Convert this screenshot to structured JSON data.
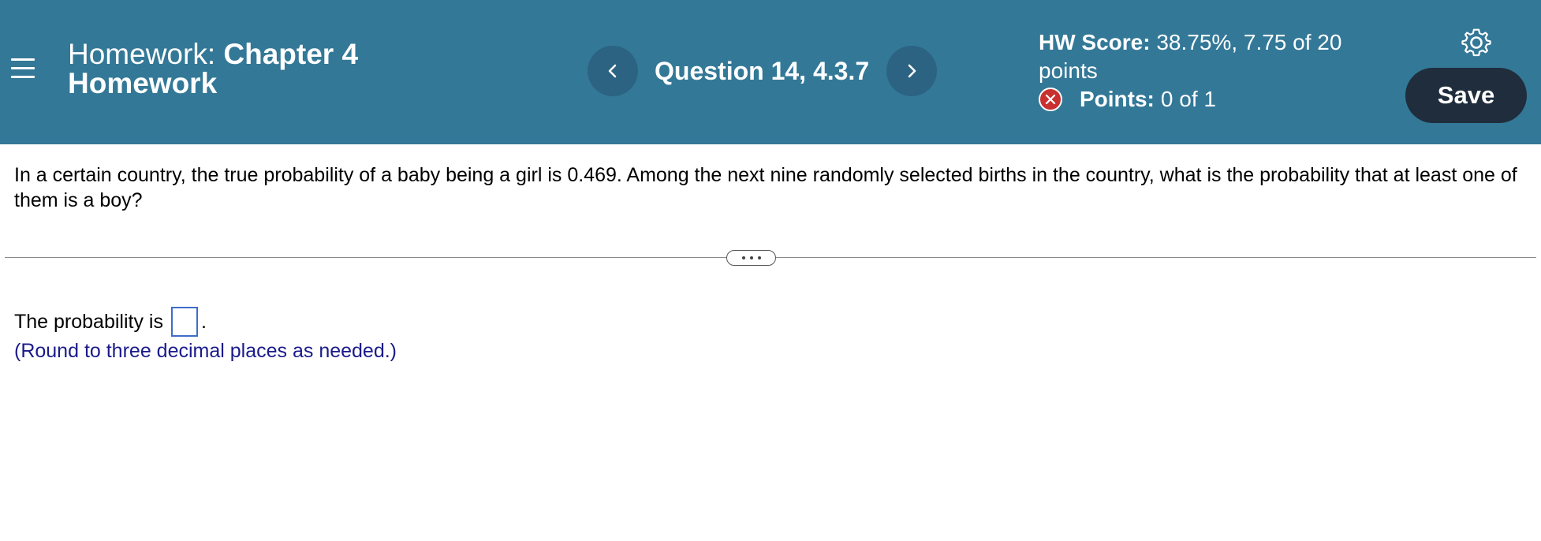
{
  "header": {
    "title_prefix": "Homework:",
    "title_bold": "Chapter 4 Homework",
    "question_label": "Question 14, 4.3.7",
    "hw_score_label": "HW Score:",
    "hw_score_value": "38.75%, 7.75 of 20 points",
    "points_label": "Points:",
    "points_value": "0 of 1",
    "save_label": "Save"
  },
  "question": {
    "text": "In a certain country, the true probability of a baby being a girl is 0.469. Among the next nine randomly selected births in the country, what is the probability that at least one of them is a boy?"
  },
  "answer": {
    "prompt": "The probability is",
    "value": "",
    "period": ".",
    "hint": "(Round to three decimal places as needed.)"
  },
  "colors": {
    "header_bg": "#337897",
    "nav_button_bg": "#2c6382",
    "save_button_bg": "#1f2d3d",
    "incorrect_badge": "#c8312f",
    "hint_text": "#1a1a8c",
    "answer_box_border": "#3f6dc9"
  },
  "icons": {
    "menu": "hamburger-menu-icon",
    "prev": "chevron-left-icon",
    "next": "chevron-right-icon",
    "status": "x-circle-icon",
    "settings": "gear-icon",
    "expander": "ellipsis-icon"
  }
}
